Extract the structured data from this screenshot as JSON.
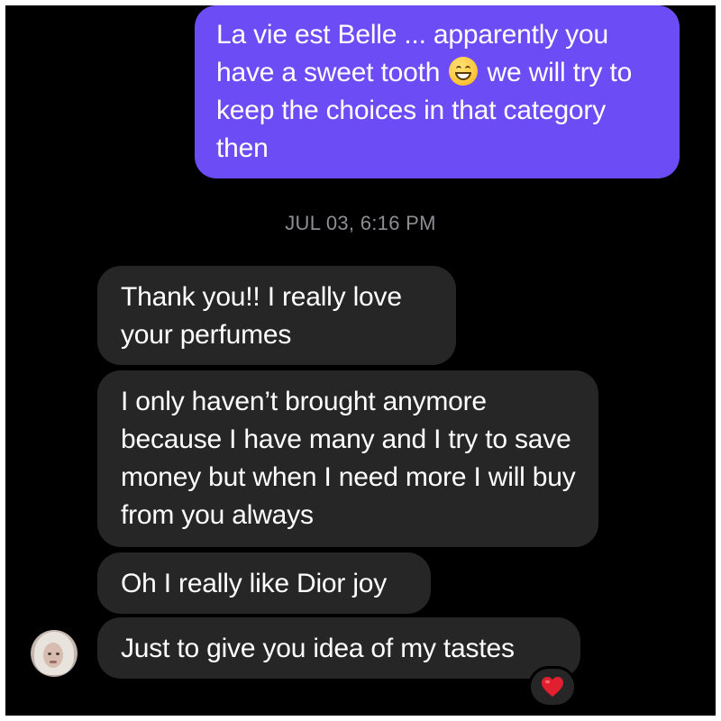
{
  "conversation": {
    "sent_message": {
      "text_before_emoji": "La vie est Belle ... apparently you have a sweet tooth",
      "emoji": "grinning-face-with-smiling-eyes",
      "text_after_emoji": "we will try to keep the choices in that category then"
    },
    "timestamp": "JUL 03, 6:16 PM",
    "received_messages": [
      {
        "text": "Thank you!! I really love your perfumes"
      },
      {
        "text": "I only haven’t brought anymore because I have many and I try to save money but when I need more I will buy from you always"
      },
      {
        "text": "Oh I really like Dior joy"
      },
      {
        "text": "Just to give you idea of my tastes"
      }
    ],
    "reaction": {
      "emoji": "❤️",
      "icon": "red-heart"
    }
  },
  "colors": {
    "background": "#000000",
    "sent_bubble": "#6c4df5",
    "received_bubble": "#262626",
    "timestamp_text": "#8d8d92",
    "heart": "#e0202f"
  }
}
